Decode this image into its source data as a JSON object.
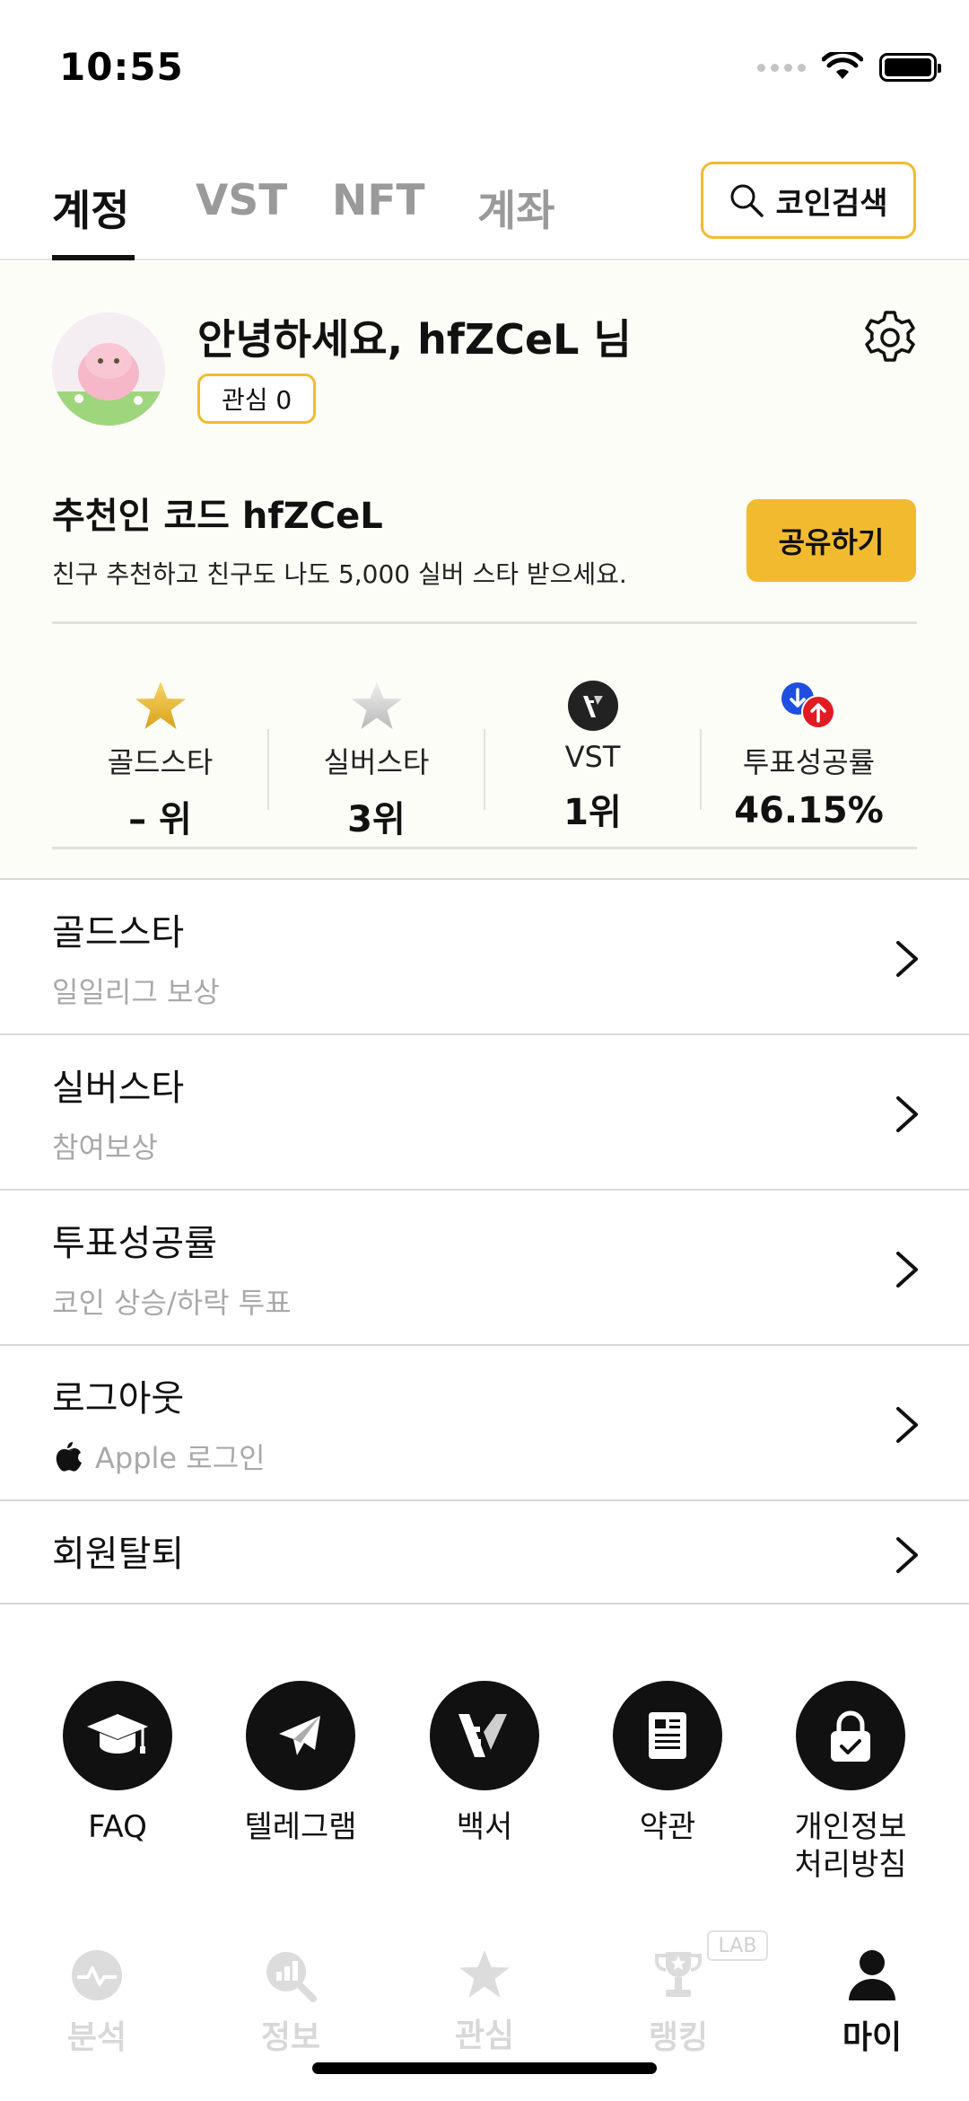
{
  "status_bar": {
    "time": "10:55"
  },
  "top_tabs": [
    {
      "label": "계정",
      "active": true
    },
    {
      "label": "VST",
      "active": false
    },
    {
      "label": "NFT",
      "active": false
    },
    {
      "label": "계좌",
      "active": false
    }
  ],
  "search_button": {
    "label": "코인검색"
  },
  "profile": {
    "greeting": "안녕하세요, hfZCeL 님",
    "interest_label": "관심 0"
  },
  "referral": {
    "title": "추천인 코드 hfZCeL",
    "description": "친구 추천하고 친구도 나도 5,000 실버 스타 받으세요.",
    "share_label": "공유하기"
  },
  "stats": [
    {
      "label": "골드스타",
      "value": "– 위",
      "icon": "gold-star-icon"
    },
    {
      "label": "실버스타",
      "value": "3위",
      "icon": "silver-star-icon"
    },
    {
      "label": "VST",
      "value": "1위",
      "icon": "vst-logo-icon"
    },
    {
      "label": "투표성공률",
      "value": "46.15%",
      "icon": "vote-updown-icon"
    }
  ],
  "menu": [
    {
      "title": "골드스타",
      "subtitle": "일일리그 보상"
    },
    {
      "title": "실버스타",
      "subtitle": "참여보상"
    },
    {
      "title": "투표성공률",
      "subtitle": "코인 상승/하락 투표"
    },
    {
      "title": "로그아웃",
      "subtitle": "Apple 로그인"
    },
    {
      "title": "회원탈퇴",
      "subtitle": ""
    }
  ],
  "shortcuts": [
    {
      "label": "FAQ",
      "icon": "graduation-cap-icon"
    },
    {
      "label": "텔레그램",
      "icon": "telegram-icon"
    },
    {
      "label": "백서",
      "icon": "vst-logo-icon"
    },
    {
      "label": "약관",
      "icon": "document-icon"
    },
    {
      "label": "개인정보\n처리방침",
      "line1": "개인정보",
      "line2": "처리방침",
      "icon": "lock-icon"
    }
  ],
  "bottom_nav": [
    {
      "label": "분석",
      "icon": "analysis-icon",
      "active": false
    },
    {
      "label": "정보",
      "icon": "info-search-icon",
      "active": false
    },
    {
      "label": "관심",
      "icon": "star-icon",
      "active": false
    },
    {
      "label": "랭킹",
      "icon": "trophy-icon",
      "active": false,
      "badge": "LAB"
    },
    {
      "label": "마이",
      "icon": "person-icon",
      "active": true
    }
  ],
  "colors": {
    "accent": "#f2bb2f",
    "section_bg": "#fdfdf7",
    "text": "#111111",
    "muted": "#a9a9a9"
  }
}
